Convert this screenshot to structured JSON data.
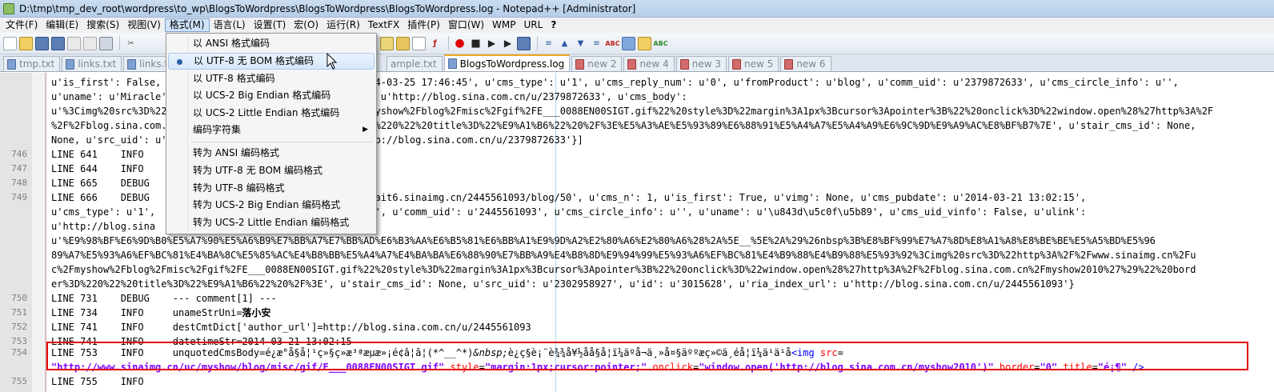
{
  "window": {
    "title": "D:\\tmp\\tmp_dev_root\\wordpress\\to_wp\\BlogsToWordpress\\BlogsToWordpress\\BlogsToWordpress.log - Notepad++ [Administrator]"
  },
  "menubar": {
    "items": [
      "文件(F)",
      "编辑(E)",
      "搜索(S)",
      "视图(V)",
      "格式(M)",
      "语言(L)",
      "设置(T)",
      "宏(O)",
      "运行(R)",
      "TextFX",
      "插件(P)",
      "窗口(W)",
      "WMP",
      "URL",
      "?"
    ],
    "active_index": 4
  },
  "tabs": [
    {
      "label": "tmp.txt",
      "dirty": false
    },
    {
      "label": "links.txt",
      "dirty": false
    },
    {
      "label": "links.txt",
      "dirty": false
    },
    {
      "label": "ample.txt",
      "dirty": false
    },
    {
      "label": "BlogsToWordpress.log",
      "dirty": false,
      "active": true
    },
    {
      "label": "new 2",
      "dirty": true
    },
    {
      "label": "new 4",
      "dirty": true
    },
    {
      "label": "new 3",
      "dirty": true
    },
    {
      "label": "new 5",
      "dirty": true
    },
    {
      "label": "new 6",
      "dirty": true
    }
  ],
  "format_menu": {
    "items": [
      {
        "label": "以 ANSI 格式编码"
      },
      {
        "label": "以 UTF-8 无 BOM 格式编码",
        "selected": true,
        "hover": true
      },
      {
        "label": "以 UTF-8 格式编码"
      },
      {
        "label": "以 UCS-2 Big Endian 格式编码"
      },
      {
        "label": "以 UCS-2 Little Endian 格式编码"
      },
      {
        "label": "编码字符集",
        "submenu": true
      },
      {
        "label": "转为 ANSI 编码格式"
      },
      {
        "label": "转为 UTF-8 无 BOM 编码格式"
      },
      {
        "label": "转为 UTF-8 编码格式"
      },
      {
        "label": "转为 UCS-2 Big Endian 编码格式"
      },
      {
        "label": "转为 UCS-2 Little Endian 编码格式"
      }
    ]
  },
  "editor": {
    "lines": [
      {
        "num": "",
        "text": "u'is_first': False, u'vimg': None, u'cms_pubdate': u'2014-03-25 17:46:45', u'cms_type': u'1', u'cms_reply_num': u'0', u'fromProduct': u'blog', u'comm_uid': u'2379872633', u'cms_circle_info': u'',"
      },
      {
        "num": "",
        "text": "u'uname': u'Miracle', u'cms_uid_vinfo': False, u'ulink': u'http://blog.sina.com.cn/u/2379872633', u'cms_body':"
      },
      {
        "num": "",
        "text": "u'%3Cimg%20src%3D%22http%3A%2F%2Fwww.sinaimg.cn%2Fuc%2Fmyshow%2Fblog%2Fmisc%2Fgif%2FE___0088EN00SIGT.gif%22%20style%3D%22margin%3A1px%3Bcursor%3Apointer%3B%22%20onclick%3D%22window.open%28%27http%3A%2F"
      },
      {
        "num": "",
        "text": "%2F%2Fblog.sina.com.cn%2Fmyshow2010%27%29%22%20border%3D%220%22%20title%3D%22%E9%A1%B6%22%20%2F%3E%E5%A3%AE%E5%93%89%E6%88%91%E5%A4%A7%E5%A4%A9%E6%9C%9D%E9%A9%AC%E8%BF%B7%7E', u'stair_cms_id': None,"
      },
      {
        "num": "",
        "text": "None, u'src_uid': u'2379872633', u'ria_index_url': u'http://blog.sina.com.cn/u/2379872633'}]"
      },
      {
        "num": "746",
        "text": "LINE 641    INFO    "
      },
      {
        "num": "747",
        "text": "LINE 644    INFO    "
      },
      {
        "num": "748",
        "text": "LINE 665    DEBUG                         parentCmdId=0"
      },
      {
        "num": "749",
        "text": "LINE 666    DEBUG                         u'http://portrait6.sinaimg.cn/2445561093/blog/50', u'cms_n': 1, u'is_first': True, u'vimg': None, u'cms_pubdate': u'2014-03-21 13:02:15',"
      },
      {
        "num": "",
        "text": "u'cms_type': u'1',                       roduct': u'blog', u'comm_uid': u'2445561093', u'cms_circle_info': u'', u'uname': u'\\u843d\\u5c0f\\u5b89', u'cms_uid_vinfo': False, u'ulink':"
      },
      {
        "num": "",
        "text": "u'http://blog.sina"
      },
      {
        "num": "",
        "text": "u'%E9%98%BF%E6%9D%B0%E5%A7%90%E5%A6%B9%E7%BB%A7%E7%BB%AD%E6%B3%AA%E6%B5%81%E6%BB%A1%E9%9D%A2%E2%80%A6%E2%80%A6%28%2A%5E__%5E%2A%29%26nbsp%3B%E8%BF%99%E7%A7%8D%E8%A1%A8%E8%BE%BE%E5%A5%BD%E5%96"
      },
      {
        "num": "",
        "text": "89%A7%E5%93%A6%EF%BC%81%E4%BA%8C%E5%85%AC%E4%B8%BB%E5%A4%A7%E4%BA%BA%E6%88%90%E7%BB%A9%E4%B8%8D%E9%94%99%E5%93%A6%EF%BC%81%E4%B9%88%E4%B9%88%E5%93%92%3Cimg%20src%3D%22http%3A%2F%2Fwww.sinaimg.cn%2Fu"
      },
      {
        "num": "",
        "text": "c%2Fmyshow%2Fblog%2Fmisc%2Fgif%2FE___0088EN00SIGT.gif%22%20style%3D%22margin%3A1px%3Bcursor%3Apointer%3B%22%20onclick%3D%22window.open%28%27http%3A%2F%2Fblog.sina.com.cn%2Fmyshow2010%27%29%22%20bord"
      },
      {
        "num": "",
        "text": "er%3D%220%22%20title%3D%22%E9%A1%B6%22%20%2F%3E', u'stair_cms_id': None, u'src_uid': u'2302958927', u'id': u'3015628', u'ria_index_url': u'http://blog.sina.com.cn/u/2445561093'}"
      },
      {
        "num": "750",
        "text": "LINE 731    DEBUG    --- comment[1] ---"
      },
      {
        "num": "751",
        "text": "LINE 734    INFO     unameStrUni="
      },
      {
        "num": "752",
        "text": "LINE 741    INFO     destCmtDict['author_url']=http://blog.sina.com.cn/u/2445561093"
      },
      {
        "num": "753",
        "text": "LINE 741    INFO     datetimeStr=2014-03-21 13:02:15"
      },
      {
        "num": "754",
        "text": "LINE 753    INFO     unquotedCmsBody="
      },
      {
        "num": "",
        "text": ""
      },
      {
        "num": "755",
        "text": "LINE 755    INFO    "
      }
    ],
    "uname_value": "落小安",
    "garbled_body": "é¿æ°å§å¦¹ç»§ç»­æ³ªæµæ»¡é¢â¦â¦(*^__^*)",
    "nbsp_entity": "&nbsp;",
    "garbled_body_2": "è¿ç§è¡¨è¾¾å¥½åå§å¦ï¼äºå¬ä¸»å¤§äººæç»©ä¸éå¦ï¼ä¹ä¹å",
    "html_tag_open": "<img",
    "html_attr_src": "src",
    "html_eq": "=",
    "html_src_value": "\"http://www.sinaimg.cn/uc/myshow/blog/misc/gif/E___0088EN00SIGT.gif\"",
    "html_attr_style": "style",
    "html_style_value": "\"margin:1px;cursor:pointer;\"",
    "html_attr_onclick": "onclick",
    "html_onclick_value": "\"window.open('http://blog.sina.com.cn/myshow2010')\"",
    "html_attr_border": "border",
    "html_border_value": "\"0\"",
    "html_attr_title": "title",
    "html_title_value": "\"é¡¶\"",
    "html_tag_close": "/>"
  },
  "colors": {
    "selection_border": "#e00000",
    "tag_color": "#0000ff",
    "attr_color": "#ff0000",
    "value_color": "#8000ff"
  }
}
